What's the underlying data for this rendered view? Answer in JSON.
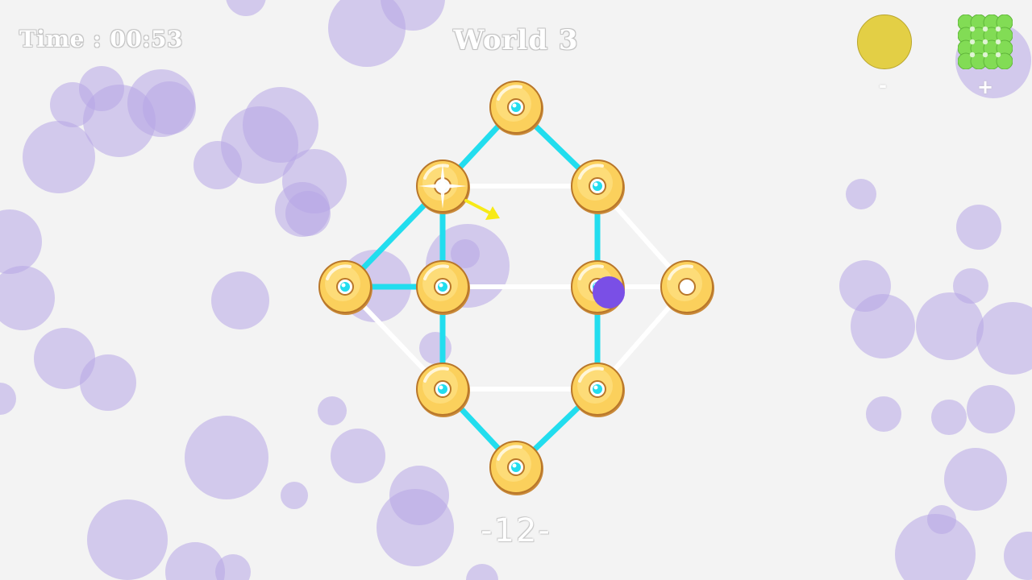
{
  "hud": {
    "timer": "Time : 00:53",
    "world": "World 3",
    "moves": "-12-"
  },
  "controls": {
    "minus_label": "-",
    "plus_label": "+",
    "minus_color": "#e3cf45",
    "plus_color": "#82dc55"
  },
  "colors": {
    "background": "#f3f3f3",
    "bubble": "#b7a6e6",
    "edge_active": "#22ddee",
    "edge_inactive": "#ffffff",
    "ring": "#fbd05c",
    "ring_outline": "#b9772a",
    "player": "#7a4fe6",
    "arrow": "#f7ea17"
  },
  "icons": {
    "minus_button": "yellow-circle-icon",
    "plus_button": "green-grid-icon",
    "direction": "arrow-icon",
    "sparkle": "sparkle-icon"
  }
}
